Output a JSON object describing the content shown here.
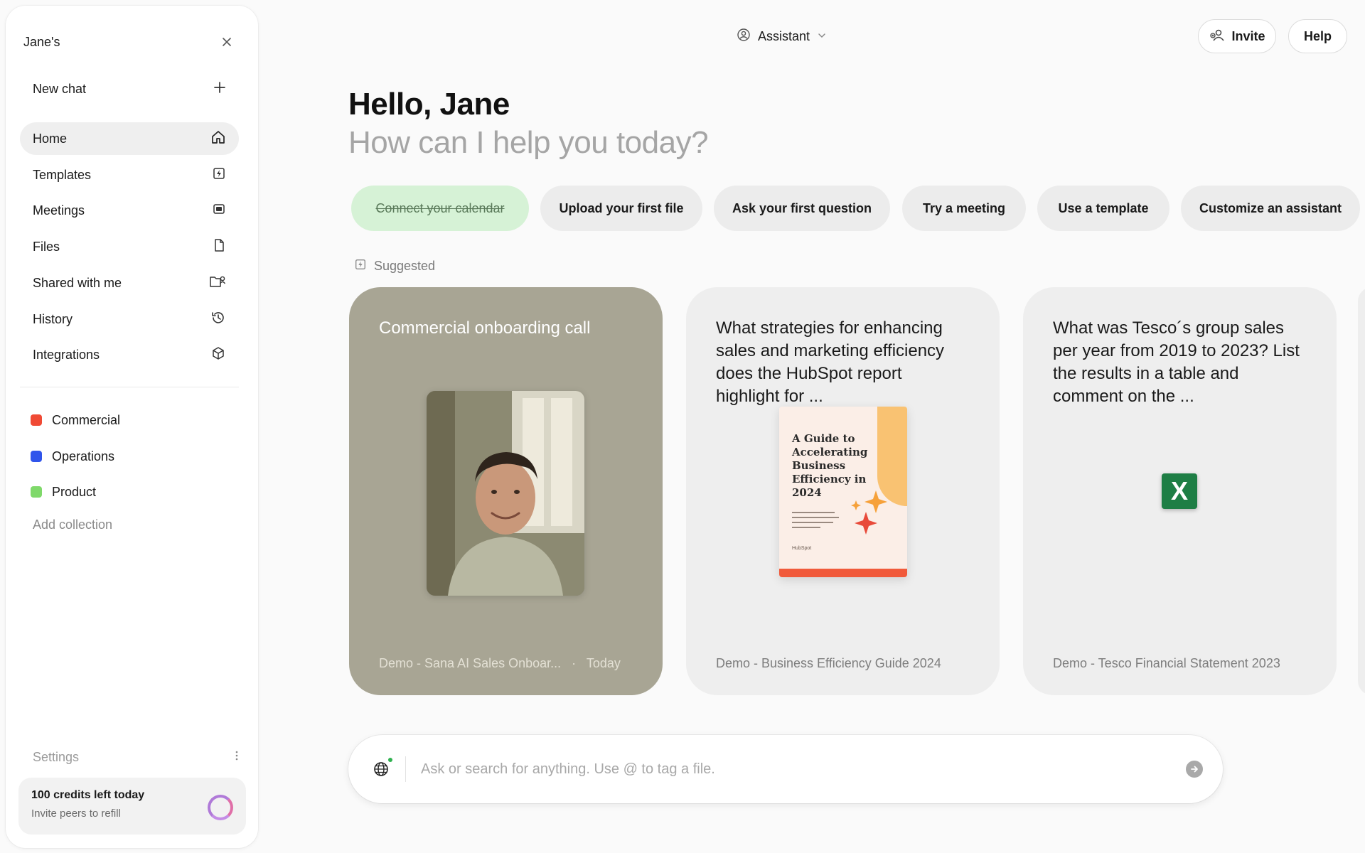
{
  "sidebar": {
    "workspace": "Jane's",
    "new_chat": "New chat",
    "items": [
      {
        "label": "Home",
        "icon": "home-icon"
      },
      {
        "label": "Templates",
        "icon": "lightning-icon"
      },
      {
        "label": "Meetings",
        "icon": "video-icon"
      },
      {
        "label": "Files",
        "icon": "file-icon"
      },
      {
        "label": "Shared with me",
        "icon": "shared-folder-icon"
      },
      {
        "label": "History",
        "icon": "history-icon"
      },
      {
        "label": "Integrations",
        "icon": "cube-icon"
      }
    ],
    "collections": [
      {
        "label": "Commercial",
        "color": "#f04a35"
      },
      {
        "label": "Operations",
        "color": "#2f54eb"
      },
      {
        "label": "Product",
        "color": "#7fd96a"
      }
    ],
    "add_collection": "Add collection",
    "settings": "Settings",
    "credits": {
      "title": "100 credits left today",
      "subtitle": "Invite peers to refill"
    }
  },
  "header": {
    "assistant": "Assistant",
    "invite": "Invite",
    "help": "Help"
  },
  "greeting": {
    "hello": "Hello, Jane",
    "sub": "How can I help you today?"
  },
  "pills": [
    {
      "label": "Connect your calendar",
      "done": true
    },
    {
      "label": "Upload your first file",
      "done": false
    },
    {
      "label": "Ask your first question",
      "done": false
    },
    {
      "label": "Try a meeting",
      "done": false
    },
    {
      "label": "Use a template",
      "done": false
    },
    {
      "label": "Customize an assistant",
      "done": false
    }
  ],
  "suggested_label": "Suggested",
  "cards": [
    {
      "title": "Commercial onboarding call",
      "footer": "Demo - Sana AI Sales Onboar...",
      "footer_time": "Today"
    },
    {
      "title": "What strategies for enhancing sales and marketing efficiency does the HubSpot report highlight for ...",
      "footer": "Demo - Business Efficiency Guide 2024",
      "doc_title": "A Guide to Accelerating Business Efficiency in 2024",
      "doc_brand": "HubSpot"
    },
    {
      "title": "What was Tesco´s group sales per year from 2019 to 2023? List the results in a table and comment on the ...",
      "footer": "Demo - Tesco Financial Statement 2023",
      "file_badge": "X"
    }
  ],
  "chat": {
    "placeholder": "Ask or search for anything. Use @ to tag a file."
  },
  "colors": {
    "accent_green": "#d6f2d6",
    "card_grey": "#a8a594",
    "excel_green": "#1e7e45"
  }
}
